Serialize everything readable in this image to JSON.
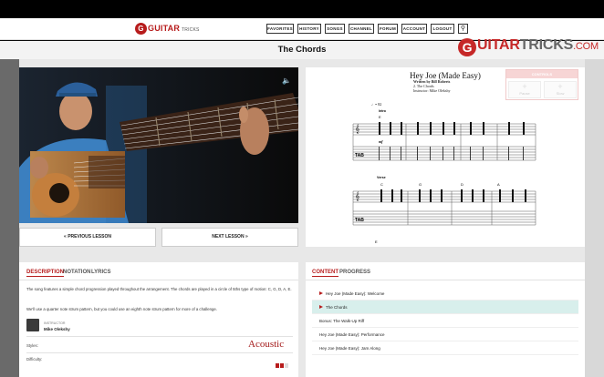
{
  "nav": {
    "logo_text": "GUITAR",
    "logo_tail": "TRICKS",
    "buttons": [
      "FAVORITES",
      "HISTORY",
      "SONGS",
      "CHANNEL",
      "FORUM",
      "ACCOUNT",
      "LOGOUT"
    ],
    "search_icon": "search-icon"
  },
  "page": {
    "title": "The Chords",
    "brand": "GUITARTRICKS.COM"
  },
  "video": {
    "volume_icon": "speaker-icon"
  },
  "lesson_nav": {
    "prev": "PREVIOUS LESSON",
    "next": "NEXT LESSON"
  },
  "sheet": {
    "title": "Hey Joe (Made Easy)",
    "written_by": "Written by Bill Roberts",
    "section": "2. The Chords",
    "instructor_line": "Instructor: Mike Olekshy",
    "tempo": "♩= 82",
    "intro_label": "Intro",
    "verse_label": "Verse",
    "dynamic": "mf",
    "chords_intro": [
      "E"
    ],
    "chords_verse": [
      "C",
      "G",
      "D",
      "A"
    ],
    "chords_bottom": [
      "E"
    ],
    "controls": {
      "header": "CONTROLS",
      "left_label": "Pause",
      "right_label": "Slow"
    }
  },
  "details": {
    "tabs": [
      "DESCRIPTION",
      "NOTATION",
      "LYRICS"
    ],
    "description_1": "The song features a simple chord progression played throughout the arrangement. The chords are played in a circle of 5ths type of motion: C, G, D, A, E.",
    "description_2": "We'll use a quarter note strum pattern, but you could use an eighth note strum pattern for more of a challenge.",
    "instructor_role": "INSTRUCTOR",
    "instructor_name": "Mike Olekshy",
    "styles_label": "Styles:",
    "style_value": "Acoustic",
    "difficulty_label": "Difficulty:"
  },
  "content": {
    "tabs": [
      "CONTENT",
      "PROGRESS"
    ],
    "items": [
      {
        "label": "Hey Joe (Made Easy): Welcome",
        "play": true,
        "active": false
      },
      {
        "label": "The Chords",
        "play": true,
        "active": true
      },
      {
        "label": "Bonus: The Walk-Up Riff",
        "play": false,
        "active": false
      },
      {
        "label": "Hey Joe (Made Easy): Performance",
        "play": false,
        "active": false
      },
      {
        "label": "Hey Joe (Made Easy): Jam Along",
        "play": false,
        "active": false
      }
    ]
  },
  "colors": {
    "accent": "#b71c1c",
    "active_row": "#d8efec"
  }
}
